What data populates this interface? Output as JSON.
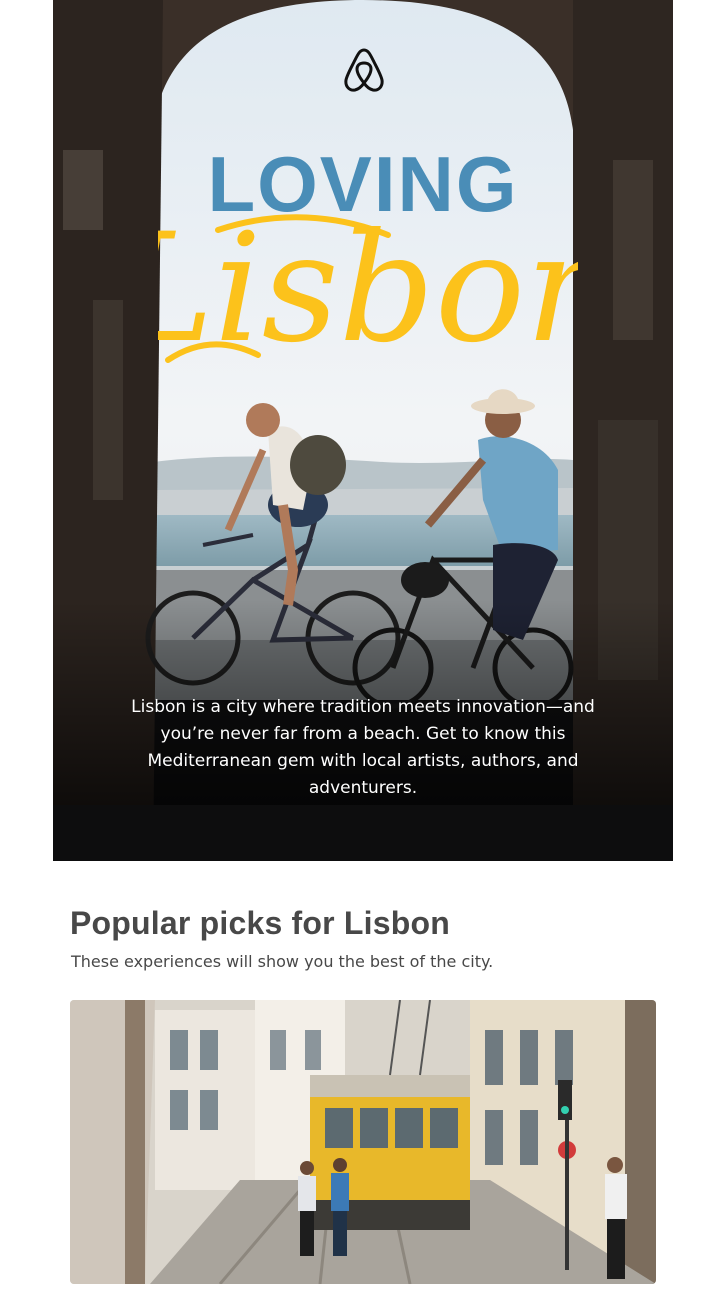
{
  "hero": {
    "logo_icon": "airbnb-belo-icon",
    "title_top": "LOVING",
    "title_script": "Lisbon",
    "title_top_color": "#4a8db7",
    "title_script_color": "#fcc21b",
    "description": "Lisbon is a city where tradition meets innovation—and you’re never far from a beach. Get to know this Mediterranean gem with local artists, authors, and adventurers."
  },
  "popular": {
    "title": "Popular picks for Lisbon",
    "subtitle": "These experiences will show you the best of the city.",
    "photo_icon": "tram-street-photo"
  },
  "colors": {
    "text_dark": "#484848",
    "tram_yellow": "#e8b82a"
  }
}
